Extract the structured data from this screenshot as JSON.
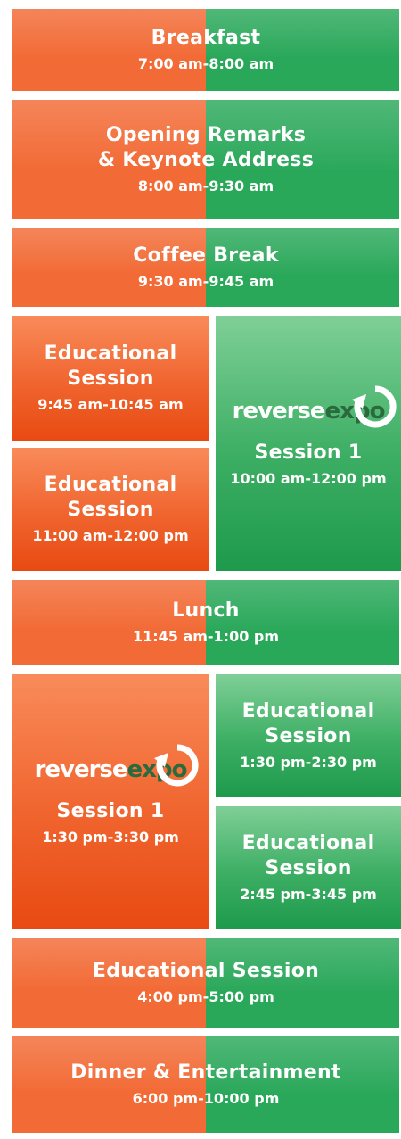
{
  "schedule": [
    {
      "title": "Breakfast",
      "time": "7:00 am-8:00 am"
    },
    {
      "title": "Opening Remarks\n& Keynote Address",
      "time": "8:00 am-9:30 am"
    },
    {
      "title": "Coffee Break",
      "time": "9:30 am-9:45 am"
    },
    {
      "title": "Educational Session",
      "time": "9:45 am-10:45 am"
    },
    {
      "title": "Educational Session",
      "time": "11:00 am-12:00 pm"
    },
    {
      "title": "Session 1",
      "time": "10:00 am-12:00 pm",
      "logo": "reverseexpo"
    },
    {
      "title": "Lunch",
      "time": "11:45 am-1:00 pm"
    },
    {
      "title": "Session 1",
      "time": "1:30 pm-3:30 pm",
      "logo": "reverseexpo"
    },
    {
      "title": "Educational Session",
      "time": "1:30 pm-2:30 pm"
    },
    {
      "title": "Educational Session",
      "time": "2:45 pm-3:45 pm"
    },
    {
      "title": "Educational Session",
      "time": "4:00 pm-5:00 pm"
    },
    {
      "title": "Dinner & Entertainment",
      "time": "6:00 pm-10:00 pm"
    }
  ],
  "logo_text": {
    "part1": "reverse",
    "part2": "expo"
  },
  "colors": {
    "orange": "#f26a35",
    "green": "#2aa85a"
  }
}
